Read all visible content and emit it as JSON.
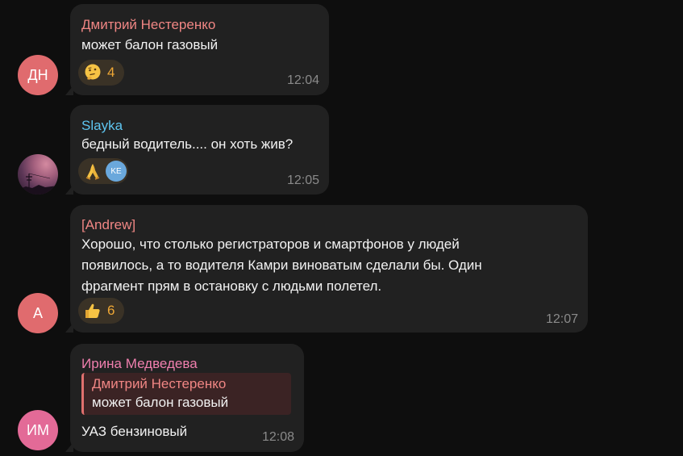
{
  "messages": [
    {
      "avatar_initials": "ДН",
      "avatar_color": "#e06b6e",
      "sender": "Дмитрий Нестеренко",
      "sender_color": "#f08684",
      "text": "может балон газовый",
      "reaction": {
        "emoji": "thinking-face",
        "count": "4"
      },
      "time": "12:04"
    },
    {
      "avatar_initials": "",
      "sender": "Slayka",
      "sender_color": "#5ec5f0",
      "text": "бедный водитель.... он хоть жив?",
      "reaction": {
        "emoji": "folded-hands",
        "reactor_initials": "KE"
      },
      "time": "12:05"
    },
    {
      "avatar_initials": "A",
      "avatar_color": "#e06b6e",
      "sender": "[Andrew]",
      "sender_color": "#f08684",
      "text_lines": [
        "Хорошо, что столько регистраторов и смартфонов у людей",
        "появилось, а то водителя Камри виноватым сделали бы. Один",
        "фрагмент прям в остановку с людьми полетел."
      ],
      "reaction": {
        "emoji": "thumbs-up",
        "count": "6"
      },
      "time": "12:07"
    },
    {
      "avatar_initials": "ИМ",
      "avatar_color": "#e36a97",
      "sender": "Ирина Медведева",
      "sender_color": "#f07fae",
      "reply": {
        "sender": "Дмитрий Нестеренко",
        "text": "может балон газовый"
      },
      "text": "УАЗ бензиновый",
      "time": "12:08"
    }
  ]
}
